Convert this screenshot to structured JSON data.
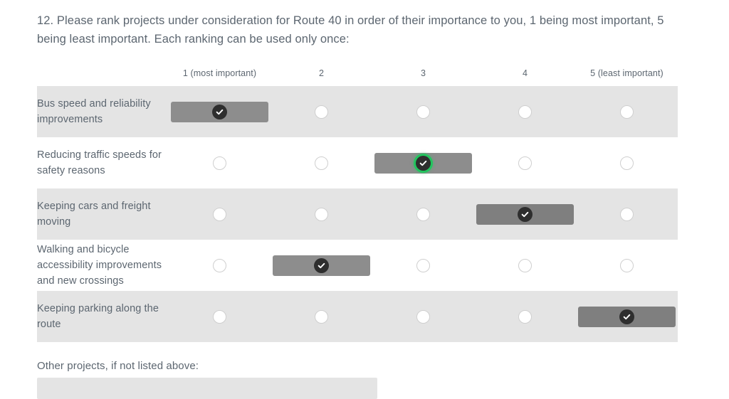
{
  "question": {
    "number": "12.",
    "text": "12. Please rank projects under consideration for Route 40 in order of their importance to you, 1 being most important, 5 being least important. Each ranking can be used only once:"
  },
  "matrix": {
    "columns": [
      {
        "label": "1 (most important)"
      },
      {
        "label": "2"
      },
      {
        "label": "3"
      },
      {
        "label": "4"
      },
      {
        "label": "5 (least important)"
      }
    ],
    "rows": [
      {
        "label": "Bus speed and reliability improvements",
        "selected": 0,
        "focused": false
      },
      {
        "label": "Reducing traffic speeds for safety reasons",
        "selected": 2,
        "focused": true
      },
      {
        "label": "Keeping cars and freight moving",
        "selected": 3,
        "focused": false
      },
      {
        "label": "Walking and bicycle accessibility improvements and new crossings",
        "selected": 1,
        "focused": false
      },
      {
        "label": "Keeping parking along the route",
        "selected": 4,
        "focused": false
      }
    ]
  },
  "other": {
    "label": "Other projects, if not listed above:",
    "value": "",
    "placeholder": ""
  },
  "colors": {
    "page_background": "#ffffff",
    "row_stripe": "#e4e4e4",
    "text": "#5c6670",
    "selected_pill": "#8d8d8d",
    "check_disc": "#2e2e2e",
    "focus_ring": "#22c55e",
    "radio_border": "#cfcfcf",
    "input_background": "#e4e4e4"
  }
}
